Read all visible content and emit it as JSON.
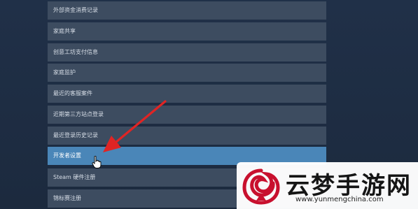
{
  "menu": {
    "items": [
      {
        "label": "外部资金消费记录",
        "active": false
      },
      {
        "label": "家庭共享",
        "active": false
      },
      {
        "label": "创意工坊支付信息",
        "active": false
      },
      {
        "label": "家庭监护",
        "active": false
      },
      {
        "label": "最近的客服案件",
        "active": false
      },
      {
        "label": "近期第三方站点登录",
        "active": false
      },
      {
        "label": "最近登录历史记录",
        "active": false
      },
      {
        "label": "开发者设置",
        "active": true
      },
      {
        "label": "Steam 硬件注册",
        "active": false
      },
      {
        "label": "锦标赛注册",
        "active": false
      }
    ]
  },
  "annotation": {
    "arrow_color": "#e02424"
  },
  "watermark": {
    "title": "云梦手游网",
    "url": "www.yunmengchina.com",
    "logo_color": "#c8102e"
  },
  "colors": {
    "background": "#1e2a3c",
    "menu_item": "#3d4c60",
    "menu_item_active": "#4a86b8",
    "menu_text": "#d6dde6"
  }
}
